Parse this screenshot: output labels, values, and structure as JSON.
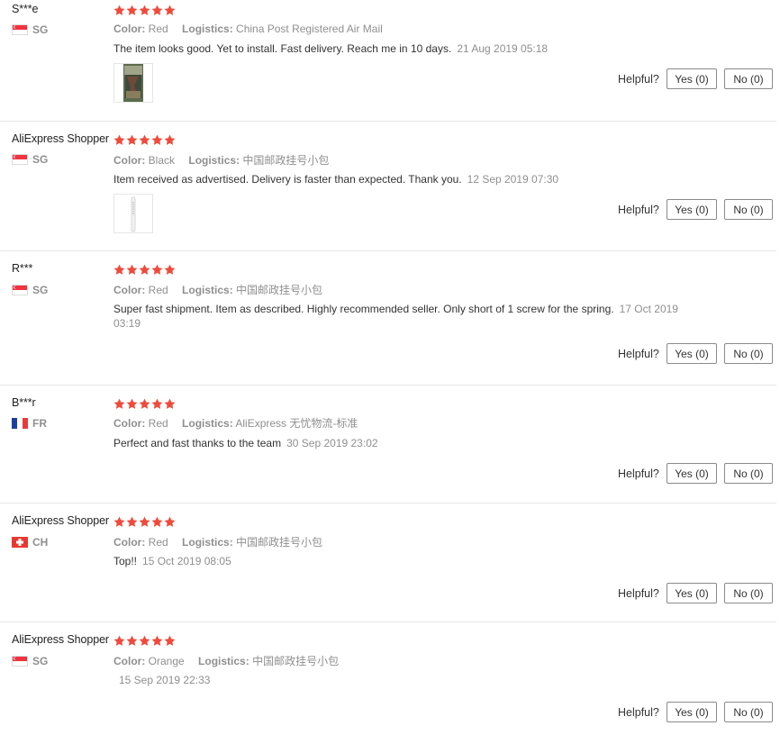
{
  "labels": {
    "color": "Color:",
    "logistics": "Logistics:",
    "helpful": "Helpful?"
  },
  "colors": {
    "star": "#ef4a3c",
    "muted": "#8f8f8f",
    "text": "#333333"
  },
  "reviews": [
    {
      "name": "S***e",
      "country": "SG",
      "flag": "sg",
      "stars": 5,
      "color": "Red",
      "logistics": "China Post Registered Air Mail",
      "text": "The item looks good. Yet to install. Fast delivery. Reach me in 10 days.",
      "date": "21 Aug 2019 05:18",
      "has_photo": true,
      "yes": "Yes (0)",
      "no": "No (0)"
    },
    {
      "name": "AliExpress Shopper",
      "country": "SG",
      "flag": "sg",
      "stars": 5,
      "color": "Black",
      "logistics": "中国邮政挂号小包",
      "text": "Item received as advertised. Delivery is faster than expected. Thank you.",
      "date": "12 Sep 2019 07:30",
      "has_photo": true,
      "yes": "Yes (0)",
      "no": "No (0)"
    },
    {
      "name": "R***",
      "country": "SG",
      "flag": "sg",
      "stars": 5,
      "color": "Red",
      "logistics": "中国邮政挂号小包",
      "text": "Super fast shipment. Item as described. Highly recommended seller. Only short of 1 screw for the spring.",
      "date": "17 Oct 2019 03:19",
      "has_photo": false,
      "yes": "Yes (0)",
      "no": "No (0)"
    },
    {
      "name": "B***r",
      "country": "FR",
      "flag": "fr",
      "stars": 5,
      "color": "Red",
      "logistics": "AliExpress 无忧物流-标准",
      "text": "Perfect and fast thanks to the team",
      "date": "30 Sep 2019 23:02",
      "has_photo": false,
      "yes": "Yes (0)",
      "no": "No (0)"
    },
    {
      "name": "AliExpress Shopper",
      "country": "CH",
      "flag": "ch",
      "stars": 5,
      "color": "Red",
      "logistics": "中国邮政挂号小包",
      "text": "Top!!",
      "date": "15 Oct 2019 08:05",
      "has_photo": false,
      "yes": "Yes (0)",
      "no": "No (0)"
    },
    {
      "name": "AliExpress Shopper",
      "country": "SG",
      "flag": "sg",
      "stars": 5,
      "color": "Orange",
      "logistics": "中国邮政挂号小包",
      "text": "",
      "date": "15 Sep 2019 22:33",
      "has_photo": false,
      "yes": "Yes (0)",
      "no": "No (0)"
    }
  ]
}
